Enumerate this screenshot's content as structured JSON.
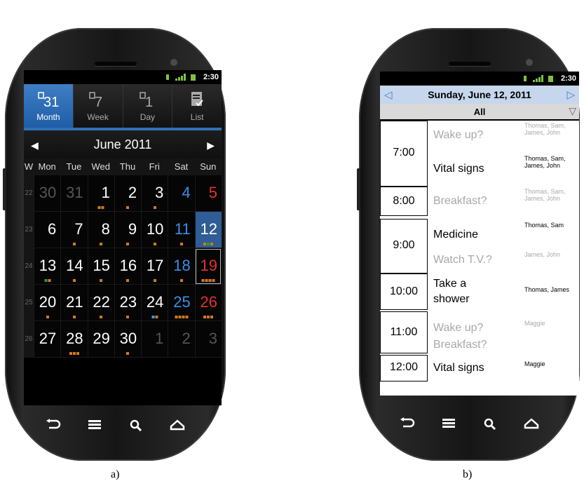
{
  "captions": {
    "left": "a)",
    "right": "b)"
  },
  "phone_a": {
    "status": {
      "time": "2:30"
    },
    "tabs": [
      {
        "label": "Month",
        "glyph": "31",
        "active": true
      },
      {
        "label": "Week",
        "glyph": "7",
        "active": false
      },
      {
        "label": "Day",
        "glyph": "1",
        "active": false
      },
      {
        "label": "List",
        "glyph": "",
        "active": false
      }
    ],
    "month_title": "June  2011",
    "weekday_header": [
      "W",
      "Mon",
      "Tue",
      "Wed",
      "Thu",
      "Fri",
      "Sat",
      "Sun"
    ],
    "weeks": [
      {
        "num": "22",
        "days": [
          "30",
          "31",
          "1",
          "2",
          "3",
          "4",
          "5"
        ]
      },
      {
        "num": "23",
        "days": [
          "6",
          "7",
          "8",
          "9",
          "10",
          "11",
          "12"
        ]
      },
      {
        "num": "24",
        "days": [
          "13",
          "14",
          "15",
          "16",
          "17",
          "18",
          "19"
        ]
      },
      {
        "num": "25",
        "days": [
          "20",
          "21",
          "22",
          "23",
          "24",
          "25",
          "26"
        ]
      },
      {
        "num": "26",
        "days": [
          "27",
          "28",
          "29",
          "30",
          "1",
          "2",
          "3"
        ]
      }
    ]
  },
  "phone_b": {
    "status": {
      "time": "2:30"
    },
    "date_title": "Sunday, June 12, 2011",
    "filter": "All",
    "times": [
      "7:00",
      "8:00",
      "9:00",
      "10:00",
      "11:00",
      "12:00"
    ],
    "activities": [
      {
        "text": "Wake up?",
        "who": "Thomas, Sam, James, John"
      },
      {
        "text": "Vital signs",
        "who": "Thomas, Sam, James, John"
      },
      {
        "text": "Breakfast?",
        "who": "Thomas, Sam, James, John"
      },
      {
        "text": "Medicine",
        "who": "Thomas, Sam"
      },
      {
        "text": "Watch T.V.?",
        "who": "James, John"
      },
      {
        "text": "Take a shower",
        "who": "Thomas, James"
      },
      {
        "text": "Wake up? Breakfast?",
        "who": "Maggie"
      },
      {
        "text": "Vital signs",
        "who": "Maggie"
      }
    ],
    "colors": {
      "header_bg": "#c6d6ec",
      "arrow": "#4a7cc0",
      "tentative_text": "#a8a8a8",
      "filter_bg": "#d9d9d9"
    }
  },
  "colors": {
    "active_tab": "#2f70b8",
    "saturday": "#3a8ee8",
    "sunday": "#e0342a",
    "selected_day": "#2f5d95",
    "event_marker_orange": "#d2791c",
    "event_marker_green": "#2e9a3a",
    "event_marker_blue": "#3aa0e0"
  }
}
